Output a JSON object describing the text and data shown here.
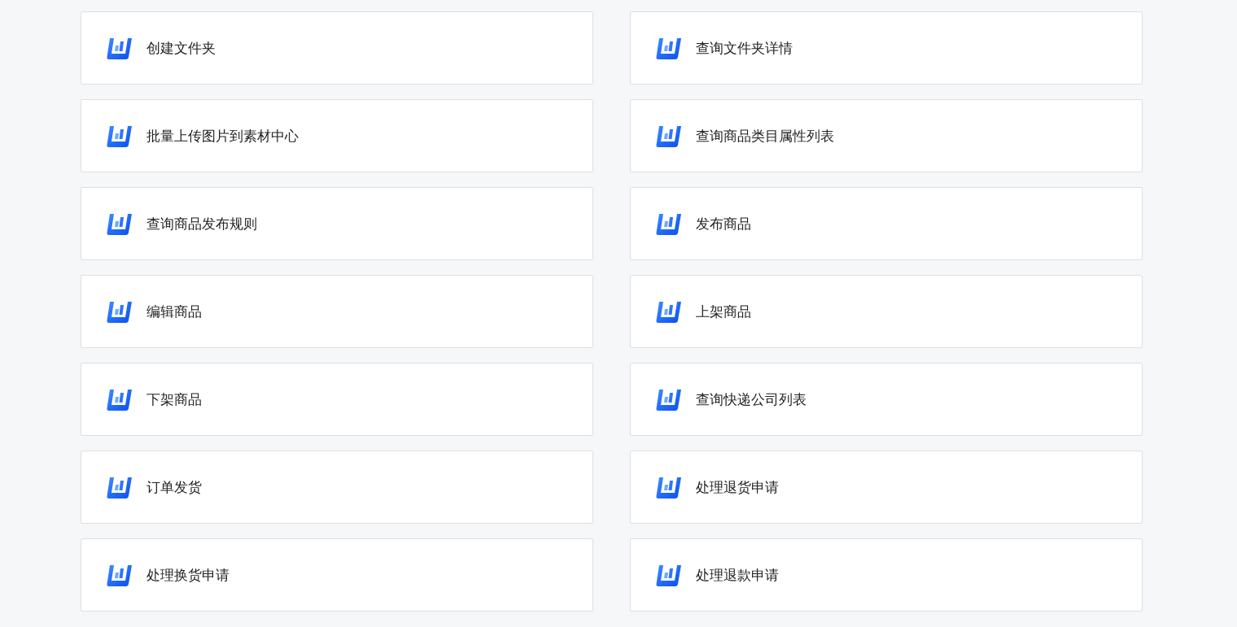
{
  "cards": [
    {
      "label": "创建文件夹"
    },
    {
      "label": "查询文件夹详情"
    },
    {
      "label": "批量上传图片到素材中心"
    },
    {
      "label": "查询商品类目属性列表"
    },
    {
      "label": "查询商品发布规则"
    },
    {
      "label": "发布商品"
    },
    {
      "label": "编辑商品"
    },
    {
      "label": "上架商品"
    },
    {
      "label": "下架商品"
    },
    {
      "label": "查询快递公司列表"
    },
    {
      "label": "订单发货"
    },
    {
      "label": "处理退货申请"
    },
    {
      "label": "处理换货申请"
    },
    {
      "label": "处理退款申请"
    }
  ]
}
